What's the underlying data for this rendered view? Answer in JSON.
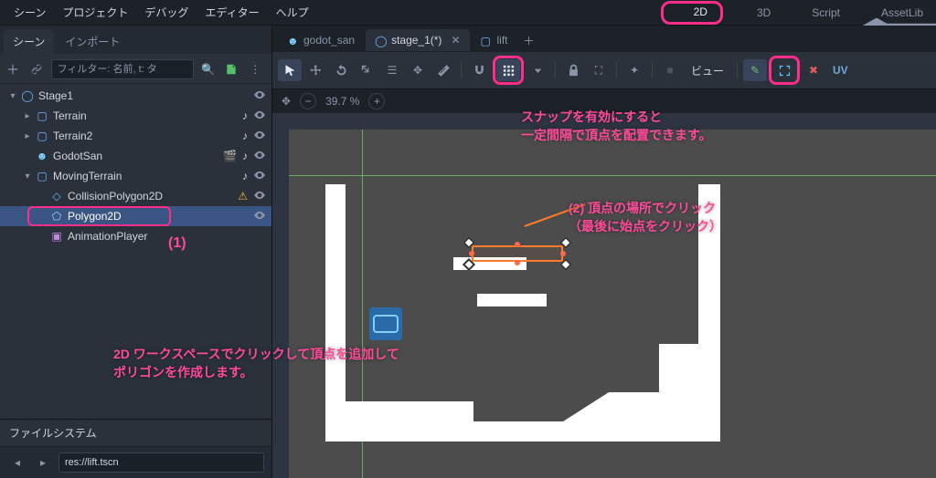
{
  "menu": {
    "items": [
      "シーン",
      "プロジェクト",
      "デバッグ",
      "エディター",
      "ヘルプ"
    ]
  },
  "workspace": {
    "btn_2d": "2D",
    "btn_3d": "3D",
    "btn_script": "Script",
    "btn_assetlib": "AssetLib"
  },
  "dock": {
    "tab_scene": "シーン",
    "tab_import": "インポート",
    "filter_placeholder": "フィルター: 名前, t: タ",
    "fs_title": "ファイルシステム",
    "fs_path": "res://lift.tscn"
  },
  "tree": [
    {
      "indent": 0,
      "expand": "v",
      "icon": "node2d",
      "name": "Stage1",
      "eye": true
    },
    {
      "indent": 1,
      "expand": ">",
      "icon": "square-blue",
      "name": "Terrain",
      "eye": true,
      "script": true
    },
    {
      "indent": 1,
      "expand": ">",
      "icon": "square-blue",
      "name": "Terrain2",
      "eye": true,
      "script": true
    },
    {
      "indent": 1,
      "expand": "",
      "icon": "robot",
      "name": "GodotSan",
      "eye": true,
      "clapper": true,
      "script": true
    },
    {
      "indent": 1,
      "expand": "v",
      "icon": "square-blue",
      "name": "MovingTerrain",
      "eye": true,
      "script": true
    },
    {
      "indent": 2,
      "expand": "",
      "icon": "collision",
      "name": "CollisionPolygon2D",
      "warn": true,
      "eye": true
    },
    {
      "indent": 2,
      "expand": "",
      "icon": "polygon",
      "name": "Polygon2D",
      "selected": true,
      "eye": true
    },
    {
      "indent": 2,
      "expand": "",
      "icon": "anim",
      "name": "AnimationPlayer"
    }
  ],
  "file_tabs": [
    {
      "icon": "robot",
      "label": "godot_san"
    },
    {
      "icon": "node2d",
      "label": "stage_1(*)",
      "active": true,
      "closable": true
    },
    {
      "icon": "square-blue",
      "label": "lift"
    }
  ],
  "zoom": {
    "value": "39.7 %"
  },
  "toolbar": {
    "view_label": "ビュー",
    "uv": "UV"
  },
  "annotations": {
    "snap_line1": "スナップを有効にすると",
    "snap_line2": "一定間隔で頂点を配置できます。",
    "click_line1": "(2) 頂点の場所でクリック",
    "click_line2": "（最後に始点をクリック）",
    "bottom_line1": "2D ワークスペースでクリックして頂点を追加して",
    "bottom_line2": "ポリゴンを作成します。",
    "label1": "(1)"
  }
}
